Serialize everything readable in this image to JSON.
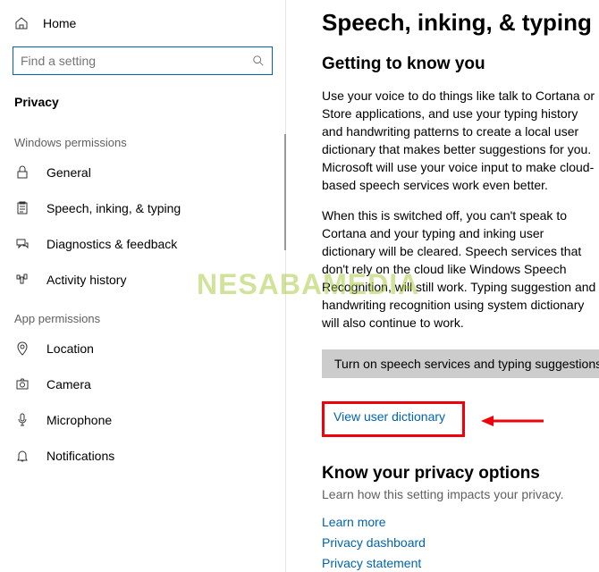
{
  "sidebar": {
    "home": "Home",
    "search_placeholder": "Find a setting",
    "section": "Privacy",
    "group1": "Windows permissions",
    "items1": [
      {
        "label": "General"
      },
      {
        "label": "Speech, inking, & typing"
      },
      {
        "label": "Diagnostics & feedback"
      },
      {
        "label": "Activity history"
      }
    ],
    "group2": "App permissions",
    "items2": [
      {
        "label": "Location"
      },
      {
        "label": "Camera"
      },
      {
        "label": "Microphone"
      },
      {
        "label": "Notifications"
      }
    ]
  },
  "main": {
    "title": "Speech, inking, & typing",
    "h1": "Getting to know you",
    "p1": "Use your voice to do things like talk to Cortana or Store applications, and use your typing history and handwriting patterns to create a local user dictionary that makes better suggestions for you. Microsoft will use your voice input to make cloud-based speech services work even better.",
    "p2": "When this is switched off, you can't speak to Cortana and your typing and inking user dictionary will be cleared. Speech services that don't rely on the cloud like Windows Speech Recognition, will still work. Typing suggestion and handwriting recognition using system dictionary will also continue to work.",
    "toggle_label": "Turn on speech services and typing suggestions",
    "link_dictionary": "View user dictionary",
    "h2": "Know your privacy options",
    "sub": "Learn how this setting impacts your privacy.",
    "links": {
      "learn": "Learn more",
      "dashboard": "Privacy dashboard",
      "statement": "Privacy statement"
    }
  },
  "watermark": "NESABAMEDIA"
}
